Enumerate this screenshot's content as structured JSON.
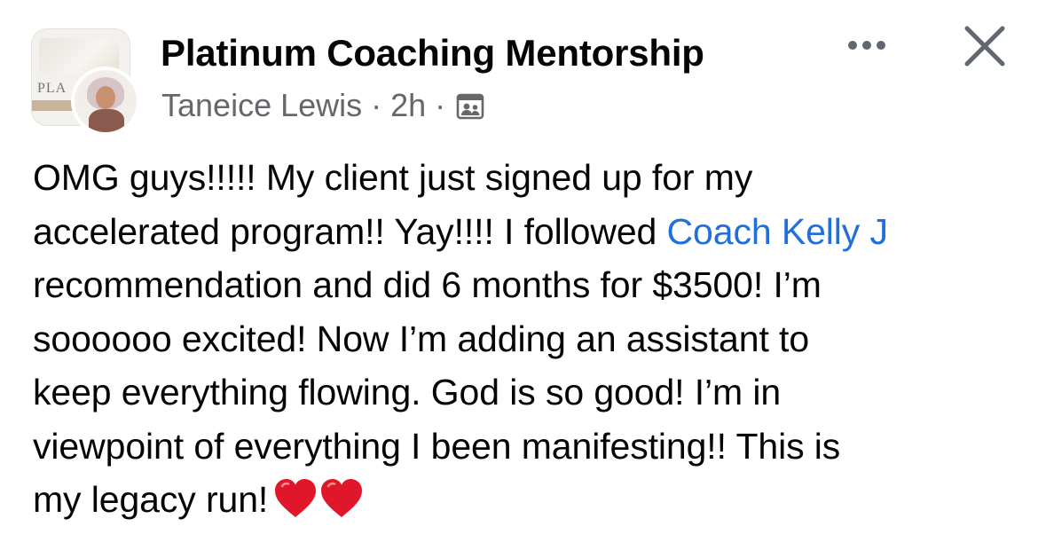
{
  "post": {
    "group_name": "Platinum Coaching Mentorship",
    "author": "Taneice Lewis",
    "time": "2h",
    "separator": "·",
    "audience_icon": "group-members-icon",
    "group_logo_text": "PLA",
    "controls": {
      "more_icon": "more-options-icon",
      "close_icon": "close-icon"
    },
    "body": {
      "line1": "OMG guys!!!!! My client just signed up for my",
      "line2_before": "accelerated program!! Yay!!!! I followed ",
      "mention": "Coach Kelly J",
      "line3": "recommendation and did 6 months for $3500! I’m",
      "line4": "soooooo excited! Now I’m adding an assistant to",
      "line5": "keep everything flowing. God is so good!  I’m in",
      "line6": "viewpoint of everything I been manifesting!!  This is",
      "line7": "my legacy run!",
      "emoji": [
        "red-heart-icon",
        "red-heart-icon"
      ]
    },
    "colors": {
      "text": "#050505",
      "secondary": "#65676b",
      "mention": "#216fdb",
      "heart": "#e0172b"
    }
  }
}
